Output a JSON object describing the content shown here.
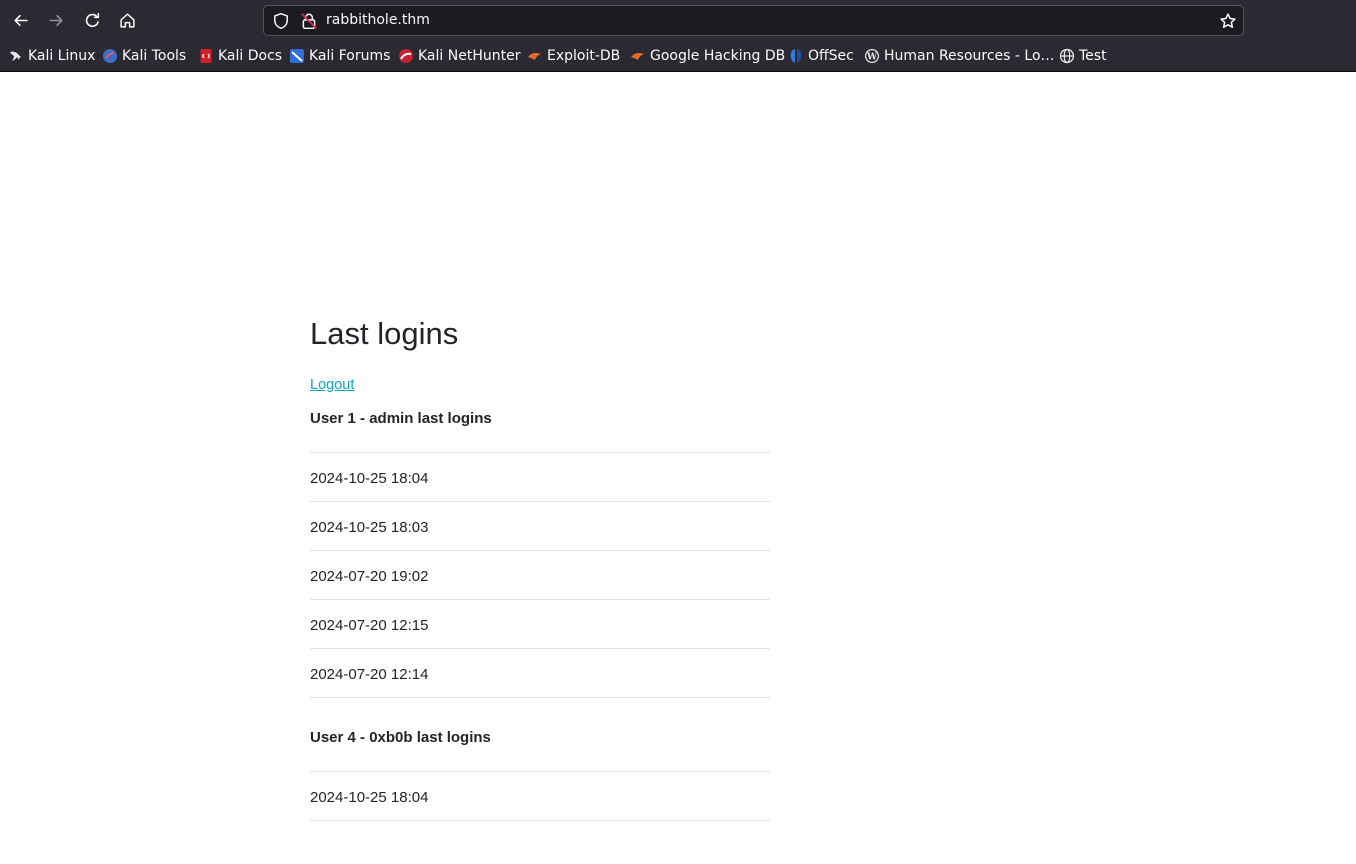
{
  "browser": {
    "url": "rabbithole.thm",
    "bookmarks": [
      {
        "label": "Kali Linux",
        "icon": "kali-dragon-icon"
      },
      {
        "label": "Kali Tools",
        "icon": "kali-tools-icon"
      },
      {
        "label": "Kali Docs",
        "icon": "kali-docs-icon"
      },
      {
        "label": "Kali Forums",
        "icon": "kali-forums-icon"
      },
      {
        "label": "Kali NetHunter",
        "icon": "kali-nethunter-icon"
      },
      {
        "label": "Exploit-DB",
        "icon": "exploit-db-icon"
      },
      {
        "label": "Google Hacking DB",
        "icon": "ghdb-icon"
      },
      {
        "label": "OffSec",
        "icon": "offsec-icon"
      },
      {
        "label": "Human Resources - Lo…",
        "icon": "wordpress-icon"
      },
      {
        "label": "Test",
        "icon": "globe-icon"
      }
    ]
  },
  "page": {
    "title": "Last logins",
    "logout_label": "Logout",
    "sections": [
      {
        "heading": "User 1 - admin last logins",
        "logins": [
          "2024-10-25 18:04",
          "2024-10-25 18:03",
          "2024-07-20 19:02",
          "2024-07-20 12:15",
          "2024-07-20 12:14"
        ]
      },
      {
        "heading": "User 4 - 0xb0b last logins",
        "logins": [
          "2024-10-25 18:04"
        ]
      }
    ]
  }
}
